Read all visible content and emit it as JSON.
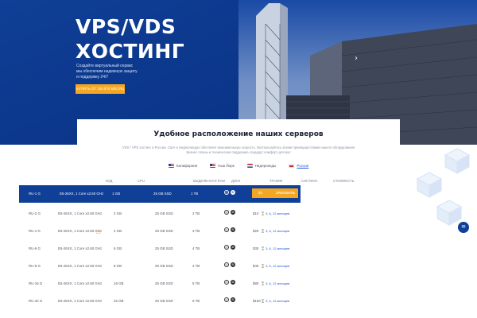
{
  "hero": {
    "title_line1": "VPS/VDS",
    "title_line2": "ХОСТИНГ",
    "desc_line1": "Создайте виртуальный сервис",
    "desc_line2": "мы обеспечим надежную защиту",
    "desc_line3": "и поддержку 24/7",
    "button_label": "КУПИТЬ ОТ 150 ₽ В МЕСЯЦ"
  },
  "section": {
    "title": "Удобное расположение наших серверов",
    "sub_line1": "VDS / VPS хостинг в России, США и Нидерландах обеспечит максимальную скорость. Воспользуйтесь всеми преимуществами нашего оборудования",
    "sub_line2": "Бизнес планы и техническая поддержка создадут комфорт для вас"
  },
  "locations": [
    {
      "label": "Калифорния",
      "flag": "us"
    },
    {
      "label": "Нью Йорк",
      "flag": "us"
    },
    {
      "label": "Нидерланды",
      "flag": "nl"
    },
    {
      "label": "Россия",
      "flag": "ru"
    }
  ],
  "table": {
    "headers": {
      "code": "КОД",
      "cpu": "CPU",
      "ram": "ВЫДЕЛЕННАЯ RAM",
      "disk": "ДИСК",
      "traffic": "ТРАФИК",
      "os": "СИСТЕМА",
      "price": "СТОИМОСТЬ"
    },
    "rows": [
      {
        "code": "RU-1 G",
        "cpu": "E5-26XX, 1 Core x2.60 GHz",
        "ram": "1 GB",
        "disk": "25 GB SSD",
        "traffic": "1 TB",
        "price": "$5",
        "order": "ЗАКАЗАТЬ",
        "period": ""
      },
      {
        "code": "RU-2 G",
        "cpu": "E5-26XX, 1 Core x2.60 GHz",
        "ram": "2 GB",
        "disk": "25 GB SSD",
        "traffic": "2 TB",
        "price": "$10",
        "order": "",
        "period": "3, 6, 12 месяцев"
      },
      {
        "code": "RU-4 G",
        "cpu": "E5-26XX, 1 Core x2.60 GHz",
        "ram": "4 GB",
        "disk": "25 GB SSD",
        "traffic": "3 TB",
        "price": "$20",
        "order": "",
        "period": "3, 6, 12 месяцев"
      },
      {
        "code": "RU-6 G",
        "cpu": "E5-26XX, 1 Core x2.60 GHz",
        "ram": "6 GB",
        "disk": "25 GB SSD",
        "traffic": "4 TB",
        "price": "$30",
        "order": "",
        "period": "3, 6, 12 месяцев"
      },
      {
        "code": "RU-8 G",
        "cpu": "E5-26XX, 1 Core x2.60 GHz",
        "ram": "8 GB",
        "disk": "25 GB SSD",
        "traffic": "4 TB",
        "price": "$40",
        "order": "",
        "period": "3, 6, 12 месяцев"
      },
      {
        "code": "RU-16 G",
        "cpu": "E5-26XX, 1 Core x2.60 GHz",
        "ram": "16 GB",
        "disk": "25 GB SSD",
        "traffic": "5 TB",
        "price": "$80",
        "order": "",
        "period": "3, 6, 12 месяцев"
      },
      {
        "code": "RU-32 G",
        "cpu": "E5-26XX, 1 Core x2.60 GHz",
        "ram": "32 GB",
        "disk": "25 GB SSD",
        "traffic": "5 TB",
        "price": "$160",
        "order": "",
        "period": "3, 6, 12 месяцев"
      }
    ]
  },
  "colors": {
    "hero_blue": "#0f3f96",
    "accent_orange": "#f5a623",
    "link_blue": "#1f57d6"
  },
  "icons": {
    "os_1": "ubuntu-icon",
    "os_2": "windows-icon",
    "chat": "chat-icon",
    "hot": "flame-icon",
    "carousel_next": "chevron-right-icon"
  }
}
